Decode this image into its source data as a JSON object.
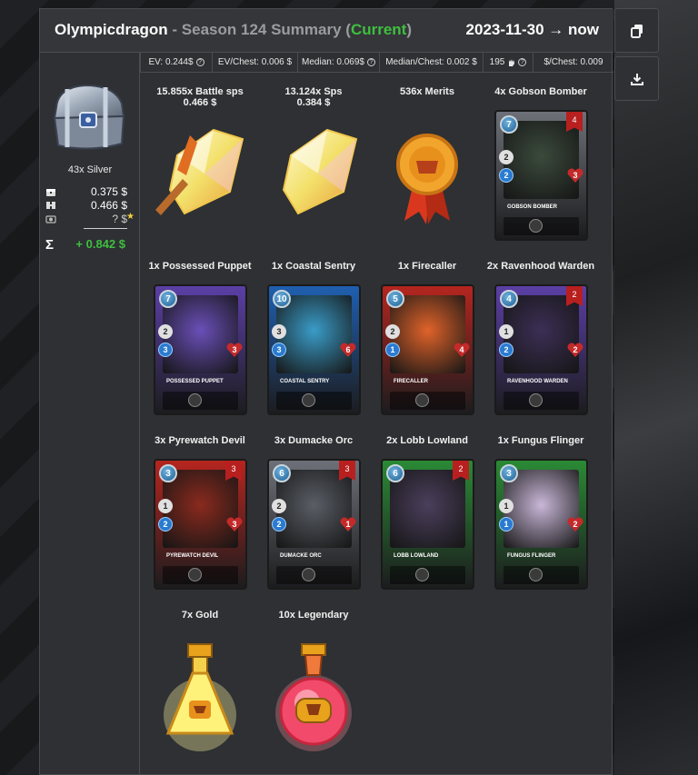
{
  "header": {
    "player": "Olympicdragon",
    "separator": " - ",
    "season_text": "Season 124 Summary (",
    "current": "Current",
    "close_paren": ")",
    "date_range": "2023-11-30 → now"
  },
  "stats": [
    {
      "label": "EV: 0.244$"
    },
    {
      "label": "EV/Chest: 0.006 $"
    },
    {
      "label": "Median: 0.069$"
    },
    {
      "label": "Median/Chest: 0.002 $"
    },
    {
      "label": "195"
    },
    {
      "label": "$/Chest: 0.009"
    }
  ],
  "sidebar": {
    "chest_label": "43x Silver",
    "rows": [
      {
        "icon": "chest-icon",
        "value": "0.375 $"
      },
      {
        "icon": "cards-icon",
        "value": "0.466 $"
      },
      {
        "icon": "potion-icon",
        "value": "? $"
      }
    ],
    "star": "★",
    "sigma": "Σ",
    "total": "+ 0.842 $"
  },
  "buttons": {
    "copy_icon": "copy-icon",
    "download_icon": "download-icon"
  },
  "rewards": [
    {
      "label": "15.855x Battle sps",
      "sub": "0.466 $",
      "kind": "crystal"
    },
    {
      "label": "13.124x Sps",
      "sub": "0.384 $",
      "kind": "crystal"
    },
    {
      "label": "536x Merits",
      "sub": "",
      "kind": "merit"
    },
    {
      "label": "4x Gobson Bomber",
      "sub": "",
      "kind": "card",
      "card": {
        "name": "Gobson Bomber",
        "mana": "7",
        "level": "4",
        "attack": "2",
        "speed": "2",
        "health": "3",
        "color": "#6d7078",
        "art": "#3b4a3c"
      }
    },
    {
      "label": "1x Possessed Puppet",
      "sub": "",
      "kind": "card",
      "card": {
        "name": "Possessed Puppet",
        "mana": "7",
        "level": "",
        "attack": "2",
        "speed": "3",
        "health": "3",
        "color": "#5b3fa6",
        "art": "#6a4fb8"
      }
    },
    {
      "label": "1x Coastal Sentry",
      "sub": "",
      "kind": "card",
      "card": {
        "name": "Coastal Sentry",
        "mana": "10",
        "level": "",
        "attack": "3",
        "speed": "3",
        "health": "6",
        "color": "#1f5fb0",
        "art": "#3a9cc8"
      }
    },
    {
      "label": "1x Firecaller",
      "sub": "",
      "kind": "card",
      "card": {
        "name": "Firecaller",
        "mana": "5",
        "level": "",
        "attack": "2",
        "speed": "1",
        "health": "4",
        "color": "#b5251f",
        "art": "#e0632a"
      }
    },
    {
      "label": "2x Ravenhood Warden",
      "sub": "",
      "kind": "card",
      "card": {
        "name": "Ravenhood Warden",
        "mana": "4",
        "level": "2",
        "attack": "1",
        "speed": "2",
        "health": "2",
        "color": "#5b3fa6",
        "art": "#3c2f55"
      }
    },
    {
      "label": "3x Pyrewatch Devil",
      "sub": "",
      "kind": "card",
      "card": {
        "name": "Pyrewatch Devil",
        "mana": "3",
        "level": "3",
        "attack": "1",
        "speed": "2",
        "health": "3",
        "color": "#b5251f",
        "art": "#8a2a1e"
      }
    },
    {
      "label": "3x Dumacke Orc",
      "sub": "",
      "kind": "card",
      "card": {
        "name": "Dumacke Orc",
        "mana": "6",
        "level": "3",
        "attack": "2",
        "speed": "2",
        "health": "1",
        "color": "#6d7078",
        "art": "#5a5e66"
      }
    },
    {
      "label": "2x Lobb Lowland",
      "sub": "",
      "kind": "card",
      "card": {
        "name": "Lobb Lowland",
        "mana": "6",
        "level": "2",
        "attack": "",
        "speed": "",
        "health": "",
        "color": "#2a8a35",
        "art": "#4b3f5c"
      }
    },
    {
      "label": "1x Fungus Flinger",
      "sub": "",
      "kind": "card",
      "card": {
        "name": "Fungus Flinger",
        "mana": "3",
        "level": "",
        "attack": "1",
        "speed": "1",
        "health": "2",
        "color": "#2a8a35",
        "art": "#c9b7d8"
      }
    },
    {
      "label": "7x Gold",
      "sub": "",
      "kind": "gold-potion"
    },
    {
      "label": "10x Legendary",
      "sub": "",
      "kind": "legendary-potion"
    }
  ]
}
